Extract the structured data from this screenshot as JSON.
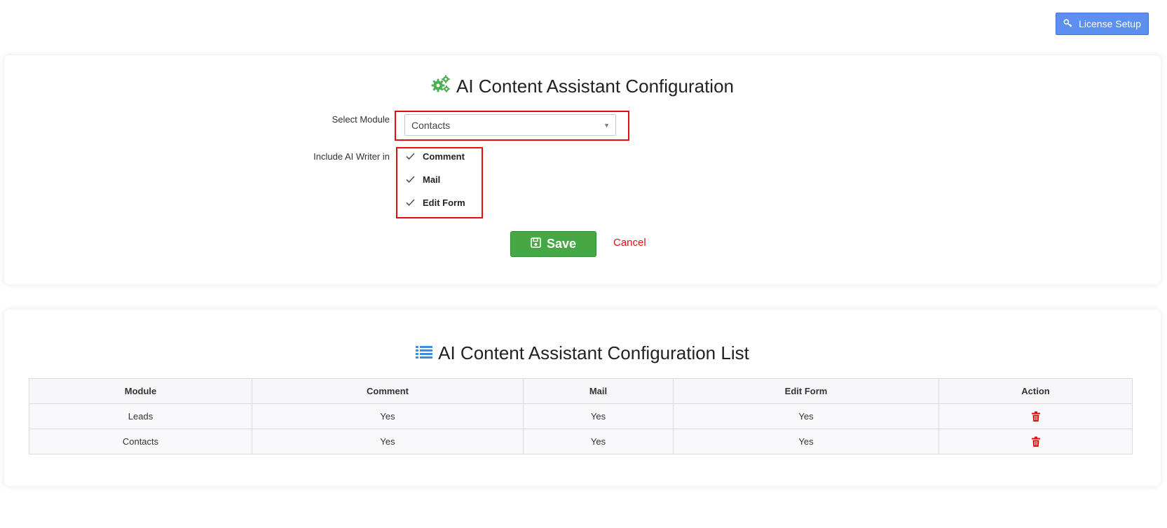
{
  "header": {
    "license_label": "License Setup"
  },
  "config": {
    "title": "AI Content Assistant Configuration",
    "select_label": "Select Module",
    "selected_module": "Contacts",
    "include_label": "Include AI Writer in",
    "options": [
      {
        "label": "Comment",
        "checked": true
      },
      {
        "label": "Mail",
        "checked": true
      },
      {
        "label": "Edit Form",
        "checked": true
      }
    ],
    "save_label": "Save",
    "cancel_label": "Cancel"
  },
  "list": {
    "title": "AI Content Assistant Configuration List",
    "columns": [
      "Module",
      "Comment",
      "Mail",
      "Edit Form",
      "Action"
    ],
    "rows": [
      {
        "module": "Leads",
        "comment": "Yes",
        "mail": "Yes",
        "edit_form": "Yes"
      },
      {
        "module": "Contacts",
        "comment": "Yes",
        "mail": "Yes",
        "edit_form": "Yes"
      }
    ]
  },
  "colors": {
    "primary": "#5b8ff0",
    "success": "#45a845",
    "danger": "#e01010",
    "gear_icon": "#4caf50",
    "list_icon": "#3b8fe0"
  },
  "icons": {
    "license": "key-icon",
    "config_title": "gears-icon",
    "list_title": "list-icon",
    "save": "floppy-disk-icon",
    "delete": "trash-icon",
    "check": "check-icon",
    "dropdown": "caret-down-icon"
  }
}
